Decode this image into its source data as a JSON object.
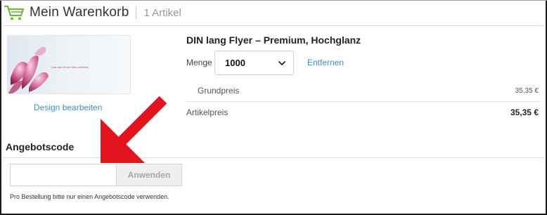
{
  "colors": {
    "accent_link": "#3a92c8",
    "cart_icon": "#6fba3a",
    "annotation_arrow": "#e4141e"
  },
  "header": {
    "title": "Mein Warenkorb",
    "item_count": "1 Artikel",
    "icon": "shopping-cart-icon"
  },
  "product": {
    "name": "DIN lang Flyer – Premium, Hochglanz",
    "thumbnail_caption": "Lass dich mit der Natur verführen",
    "design_link": "Design bearbeiten",
    "quantity_label": "Menge",
    "quantity_value": "1000",
    "remove_link": "Entfernen",
    "base_price_label": "Grundpreis",
    "base_price_value": "35,35 €",
    "item_price_label": "Artikelpreis",
    "item_price_value": "35,35 €"
  },
  "coupon": {
    "heading": "Angebotscode",
    "input_value": "",
    "input_placeholder": "",
    "button_label": "Anwenden",
    "note": "Pro Bestellung bitte nur einen Angebotscode verwenden."
  }
}
